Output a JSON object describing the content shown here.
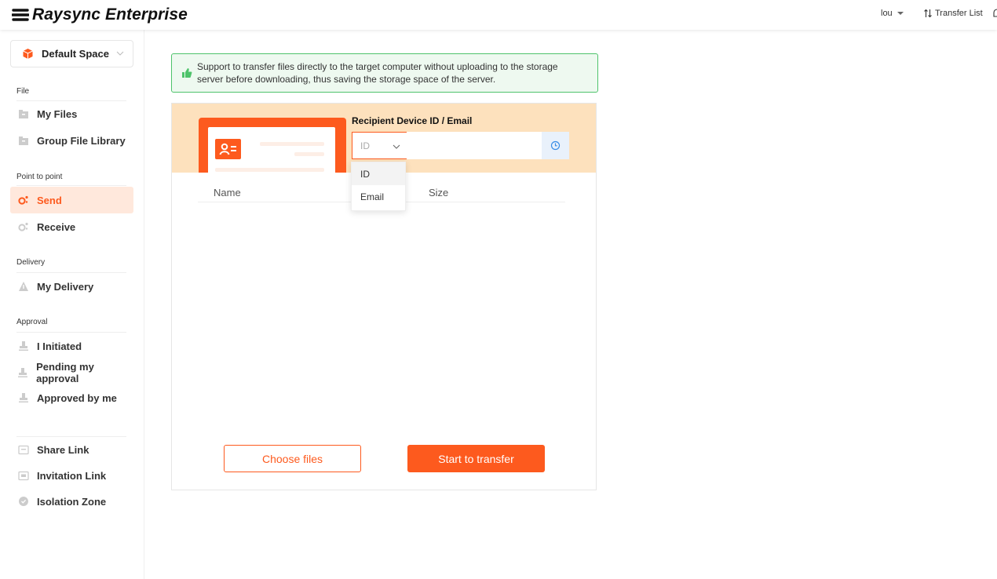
{
  "app": {
    "logo_text": "Raysync Enterprise"
  },
  "header": {
    "user": "lou",
    "transfer_list": "Transfer List"
  },
  "sidebar": {
    "space": {
      "label": "Default Space"
    },
    "sections": {
      "file": "File",
      "point_to_point": "Point to point",
      "delivery": "Delivery",
      "approval": "Approval"
    },
    "items": {
      "my_files": "My Files",
      "group_file_library": "Group File Library",
      "send": "Send",
      "receive": "Receive",
      "my_delivery": "My Delivery",
      "i_initiated": "I Initiated",
      "pending_my_approval": "Pending my approval",
      "approved_by_me": "Approved by me",
      "share_link": "Share Link",
      "invitation_link": "Invitation Link",
      "isolation_zone": "Isolation Zone"
    },
    "active": "Send"
  },
  "notice": {
    "text": "Support to transfer files directly to the target computer without uploading to the storage server before downloading, thus saving the storage space of the server."
  },
  "recipient": {
    "title": "Recipient Device ID / Email",
    "type_value": "ID",
    "input_value": "",
    "type_options": [
      "ID",
      "Email"
    ]
  },
  "table": {
    "columns": [
      "Name",
      "Size"
    ]
  },
  "buttons": {
    "choose_files": "Choose files",
    "start_transfer": "Start to transfer"
  },
  "colors": {
    "accent": "#fd5a1e",
    "banner": "#fde1bd",
    "notice_border": "#4ec36b",
    "notice_bg": "#eef9f0"
  }
}
